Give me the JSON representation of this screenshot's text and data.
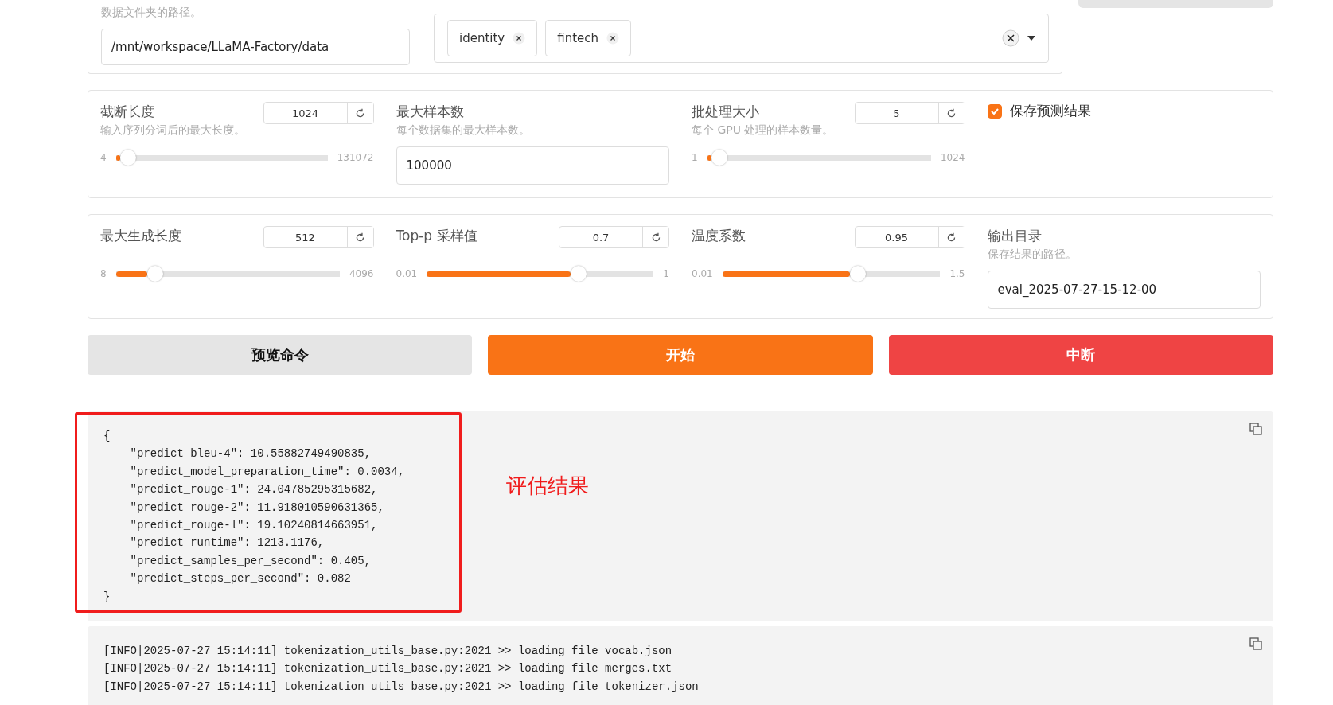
{
  "dataset_dir": {
    "hint": "数据文件夹的路径。",
    "value": "/mnt/workspace/LLaMA-Factory/data"
  },
  "dataset": {
    "tags": [
      "identity",
      "fintech"
    ]
  },
  "row1": [
    {
      "kind": "slider",
      "label": "截断长度",
      "hint": "输入序列分词后的最大长度。",
      "value": "1024",
      "min": "4",
      "max": "131072",
      "level": 0.02
    },
    {
      "kind": "textbox",
      "label": "最大样本数",
      "hint": "每个数据集的最大样本数。",
      "value": "100000"
    },
    {
      "kind": "slider",
      "label": "批处理大小",
      "hint": "每个 GPU 处理的样本数量。",
      "value": "5",
      "min": "1",
      "max": "1024",
      "level": 0.02
    },
    {
      "kind": "checkbox",
      "label": "保存预测结果",
      "checked": true
    }
  ],
  "row2": [
    {
      "kind": "slider",
      "label": "最大生成长度",
      "value": "512",
      "min": "8",
      "max": "4096",
      "level": 0.15
    },
    {
      "kind": "slider",
      "label": "Top-p 采样值",
      "value": "0.7",
      "min": "0.01",
      "max": "1",
      "level": 0.68
    },
    {
      "kind": "slider",
      "label": "温度系数",
      "value": "0.95",
      "min": "0.01",
      "max": "1.5",
      "level": 0.63
    },
    {
      "kind": "textbox",
      "label": "输出目录",
      "hint": "保存结果的路径。",
      "value": "eval_2025-07-27-15-12-00"
    }
  ],
  "buttons": [
    {
      "label": "预览命令",
      "kind": "secondary"
    },
    {
      "label": "开始",
      "kind": "primary"
    },
    {
      "label": "中断",
      "kind": "stop"
    }
  ],
  "result": {
    "annotation": "评估结果",
    "lines": [
      "{",
      "    \"predict_bleu-4\": 10.55882749490835,",
      "    \"predict_model_preparation_time\": 0.0034,",
      "    \"predict_rouge-1\": 24.04785295315682,",
      "    \"predict_rouge-2\": 11.918010590631365,",
      "    \"predict_rouge-l\": 19.10240814663951,",
      "    \"predict_runtime\": 1213.1176,",
      "    \"predict_samples_per_second\": 0.405,",
      "    \"predict_steps_per_second\": 0.082",
      "}"
    ]
  },
  "log": {
    "lines": [
      "[INFO|2025-07-27 15:14:11] tokenization_utils_base.py:2021 >> loading file vocab.json",
      "[INFO|2025-07-27 15:14:11] tokenization_utils_base.py:2021 >> loading file merges.txt",
      "[INFO|2025-07-27 15:14:11] tokenization_utils_base.py:2021 >> loading file tokenizer.json"
    ]
  }
}
